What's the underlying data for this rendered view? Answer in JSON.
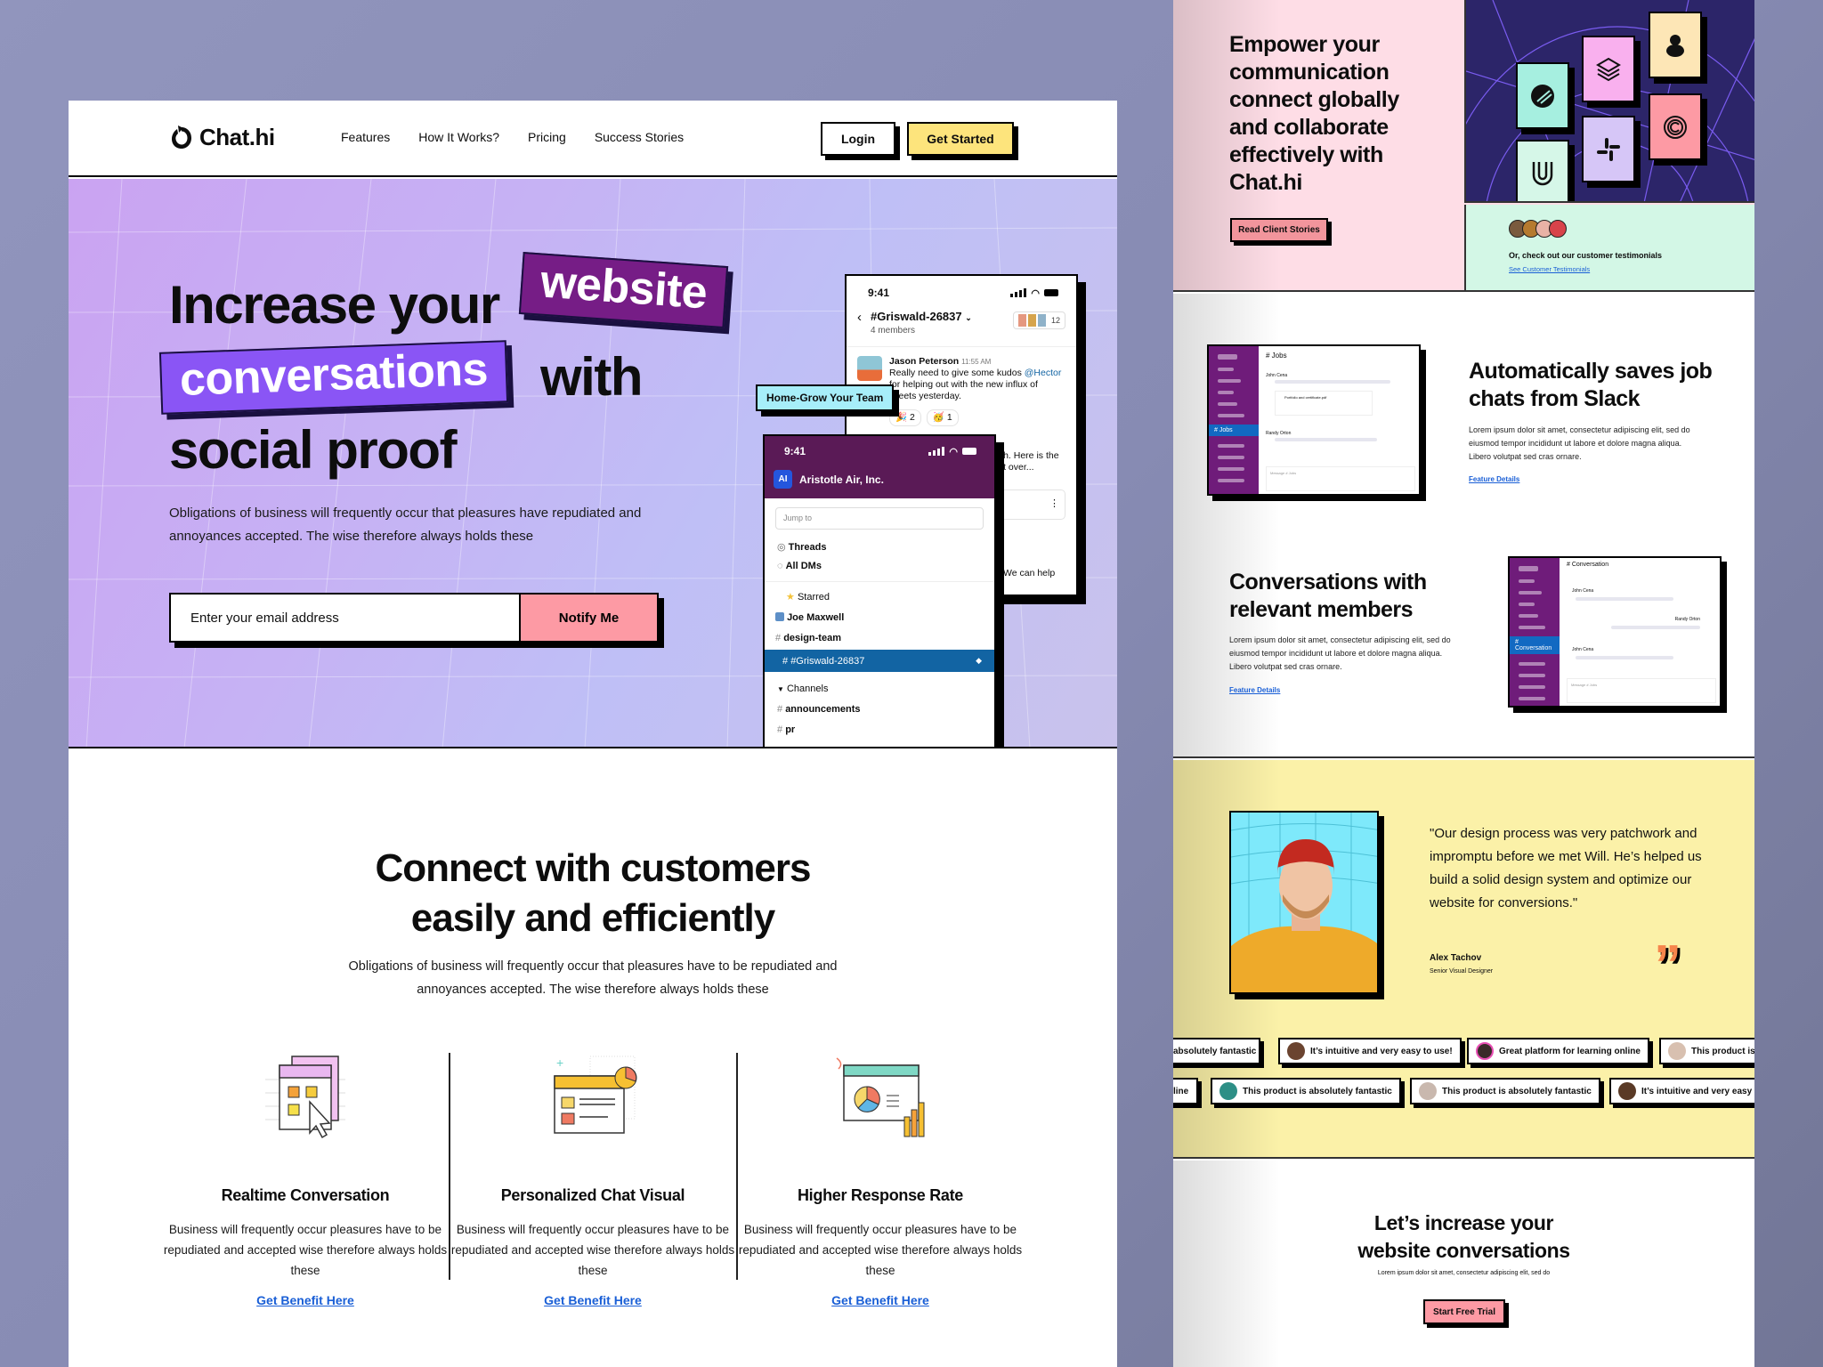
{
  "left": {
    "nav": {
      "brand": "Chat.hi",
      "links": [
        "Features",
        "How It Works?",
        "Pricing",
        "Success Stories"
      ],
      "login_label": "Login",
      "get_started_label": "Get Started"
    },
    "hero": {
      "title_part1": "Increase your",
      "title_tag1": "website",
      "title_tag2": "conversations",
      "title_part2": "with",
      "title_part3": "social proof",
      "subtitle": "Obligations of business will frequently occur that pleasures have repudiated and annoyances accepted. The wise therefore always holds these",
      "email_placeholder": "Enter your email address",
      "notify_label": "Notify Me",
      "floating_label": "Home-Grow Your Team",
      "phone_chat": {
        "time": "9:41",
        "channel": "#Griswald-26837",
        "members": "4 members",
        "member_count": "12",
        "message_author": "Jason Peterson",
        "message_time": "11:55 AM",
        "message_text_pre": "Really need to give some kudos ",
        "message_mention": "@Hector",
        "message_text_post": " for helping out with the new influx of tweets yesterday.",
        "reactions": [
          {
            "emoji": "🎉",
            "count": "2"
          },
          {
            "emoji": "🥳",
            "count": "1"
          }
        ],
        "partial_text_1": "uch. Here is the",
        "partial_text_2": "d it over...",
        "partial_text_3": "We can help"
      },
      "phone_sidebar": {
        "time": "9:41",
        "workspace_initials": "AI",
        "workspace_name": "Aristotle Air, Inc.",
        "jump_placeholder": "Jump to",
        "threads": "Threads",
        "all_dms": "All DMs",
        "starred": "Starred",
        "dm": "Joe Maxwell",
        "channel_design": "design-team",
        "active_channel": "#Griswald-26837",
        "channels_header": "Channels",
        "channel_announcements": "announcements",
        "channel_pr": "pr"
      }
    },
    "connect": {
      "title_line1": "Connect with customers",
      "title_line2": "easily and efficiently",
      "subtitle": "Obligations of business will frequently occur that pleasures have to be repudiated and annoyances accepted. The wise therefore always holds  these",
      "features": [
        {
          "title": "Realtime Conversation",
          "text": "Business will frequently occur pleasures have to be repudiated and accepted wise therefore always holds  these",
          "link": "Get Benefit Here",
          "icon": "folder-window-cursor-icon"
        },
        {
          "title": "Personalized Chat Visual",
          "text": "Business will frequently occur pleasures have to be repudiated and accepted wise therefore always holds  these",
          "link": "Get Benefit Here",
          "icon": "dashboard-window-icon"
        },
        {
          "title": "Higher Response Rate",
          "text": "Business will frequently occur pleasures have to be repudiated and accepted wise therefore always holds  these",
          "link": "Get Benefit Here",
          "icon": "analytics-chart-icon"
        }
      ]
    }
  },
  "right": {
    "empower": {
      "title": "Empower your communication connect globally and collaborate effectively with Chat.hi",
      "button": "Read Client Stories",
      "testimonial_prompt": "Or, check out our customer testimonials",
      "testimonial_link": "See Customer Testimonials",
      "logos": [
        "feather-logo",
        "layers-logo",
        "ampersand-logo",
        "u-logo",
        "slack-logo",
        "c-spiral-logo"
      ]
    },
    "feature1": {
      "title": "Automatically saves job chats from Slack",
      "text": "Lorem ipsum dolor sit amet, consectetur adipiscing elit, sed do eiusmod tempor incididunt ut labore et dolore magna aliqua. Libero volutpat sed cras ornare.",
      "link": "Feature Details",
      "mock_channel": "# Jobs",
      "mock_user1": "John Cena",
      "mock_file": "Portfolio and certificate.pdf",
      "mock_user2": "Randy Orton",
      "mock_input": "Message # Jobs"
    },
    "feature2": {
      "title": "Conversations with relevant members",
      "text": "Lorem ipsum dolor sit amet, consectetur adipiscing elit, sed do eiusmod tempor incididunt ut labore et dolore magna aliqua. Libero volutpat sed cras ornare.",
      "link": "Feature Details",
      "mock_channel": "# Conversation",
      "mock_user1": "John Cena",
      "mock_user2": "Randy Orton",
      "mock_input": "Message # Jobs"
    },
    "testimonial": {
      "quote": "\"Our design process was very patchwork and impromptu before we met Will. He’s helped us build a solid design system and optimize our website for conversions.\"",
      "name": "Alex Tachov",
      "role": "Senior Visual Designer",
      "chips_row1": [
        "absolutely fantastic",
        "It’s intuitive and very easy to use!",
        "Great platform for learning online",
        "This product is"
      ],
      "chips_row2": [
        "line",
        "This product is absolutely fantastic",
        "This product is absolutely fantastic",
        "It’s intuitive and very easy to"
      ]
    },
    "cta": {
      "title_line1": "Let’s increase your",
      "title_line2": "website conversations",
      "text": "Lorem ipsum dolor sit amet, consectetur adipiscing elit, sed do",
      "button": "Start Free Trial"
    }
  },
  "colors": {
    "backdrop": "#8a8eb6",
    "hero_purple": "#c6b2f4",
    "tag_dark_purple": "#761d86",
    "tag_violet": "#8a55f5",
    "yellow": "#fde47c",
    "pink": "#fd9aa4",
    "slack_purple": "#5a1a56",
    "slack_blue": "#1264a3",
    "link_blue": "#1a5fd6",
    "mint": "#d3f7e6",
    "navy": "#2c2569",
    "testimonial_yellow": "#fbf1a8"
  }
}
